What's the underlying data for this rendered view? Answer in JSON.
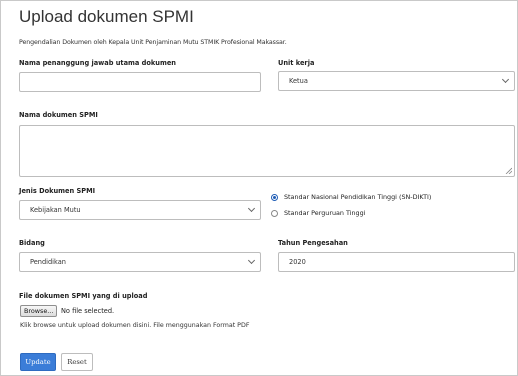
{
  "form": {
    "title": "Upload dokumen SPMI",
    "subtitle": "Pengendalian Dokumen oleh Kepala Unit Penjaminan Mutu STMIK Profesional Makassar.",
    "penanggung_jawab": {
      "label": "Nama penanggung jawab utama dokumen",
      "value": ""
    },
    "unit_kerja": {
      "label": "Unit kerja",
      "selected": "Ketua"
    },
    "nama_dokumen": {
      "label": "Nama dokumen SPMI",
      "value": ""
    },
    "jenis_dokumen": {
      "label": "Jenis Dokumen SPMI",
      "selected": "Kebijakan Mutu"
    },
    "standar": {
      "options": [
        {
          "label": "Standar Nasional Pendidikan Tinggi (SN-DIKTI)",
          "checked": true
        },
        {
          "label": "Standar Perguruan Tinggi",
          "checked": false
        }
      ]
    },
    "bidang": {
      "label": "Bidang",
      "selected": "Pendidikan"
    },
    "tahun_pengesahan": {
      "label": "Tahun Pengesahan",
      "value": "2020"
    },
    "file": {
      "label": "File dokumen SPMI yang di upload",
      "browse_label": "Browse...",
      "status": "No file selected.",
      "help": "Klik browse untuk upload dokumen disini. File menggunakan Format PDF"
    },
    "actions": {
      "update_label": "Update",
      "reset_label": "Reset",
      "update_color": "#3b7dd8"
    }
  }
}
